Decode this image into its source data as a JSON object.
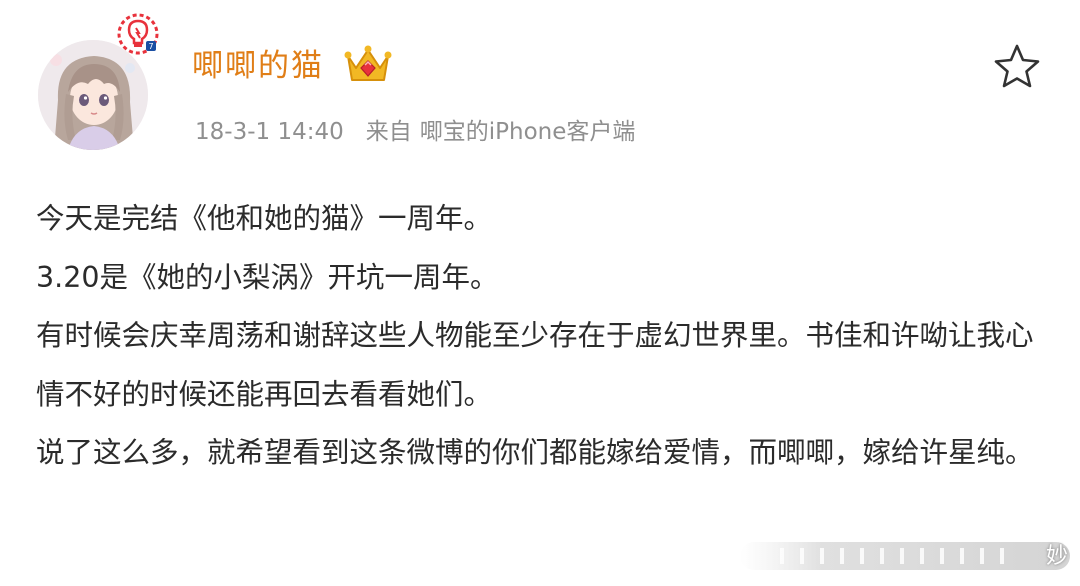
{
  "user": {
    "name": "唧唧的猫",
    "avatar_icon": "anime-girl-avatar",
    "badge_icon": "lightbulb-verified-icon",
    "level_icon": "gold-crown-icon"
  },
  "meta": {
    "time": "18-3-1 14:40",
    "from_prefix": "来自",
    "source": "唧宝的iPhone客户端"
  },
  "actions": {
    "favorite_icon": "star-outline-icon"
  },
  "content": {
    "lines": [
      "今天是完结《他和她的猫》一周年。",
      "3.20是《她的小梨涡》开坑一周年。",
      "有时候会庆幸周荡和谢辞这些人物能至少存在于虚幻世界里。书佳和许呦让我心情不好的时候还能再回去看看她们。",
      "说了这么多，就希望看到这条微博的你们都能嫁给爱情，而唧唧，嫁给许星纯。"
    ]
  },
  "watermark": {
    "text": "妙"
  },
  "colors": {
    "username": "#e07e17",
    "meta": "#8f8f8f",
    "text": "#2b2b2b",
    "badge_red": "#e8323c"
  }
}
